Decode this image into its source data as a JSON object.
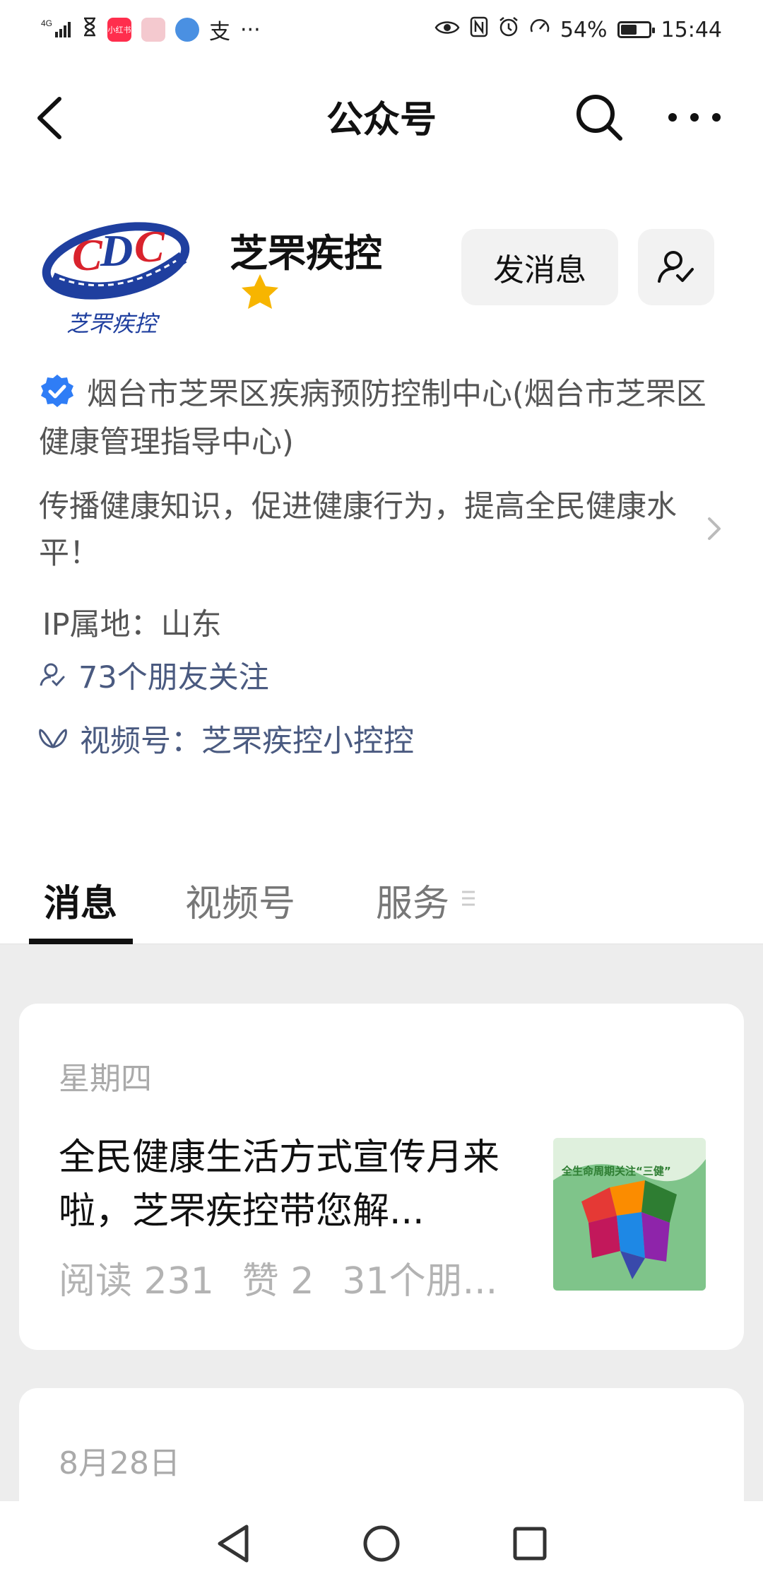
{
  "status_bar": {
    "network": "4G",
    "app_chip_label": "小红书",
    "extra_label": "支",
    "more": "···",
    "battery": "54%",
    "time": "15:44"
  },
  "header": {
    "title": "公众号"
  },
  "account": {
    "name": "芝罘疾控",
    "logo_caption": "芝罘疾控",
    "message_button": "发消息",
    "verified_org": "烟台市芝罘区疾病预防控制中心(烟台市芝罘区健康管理指导中心)",
    "description": "传播健康知识，促进健康行为，提高全民健康水平！",
    "ip_location": "IP属地：山东",
    "friends_following": "73个朋友关注",
    "channels": "视频号：芝罘疾控小控控"
  },
  "tabs": [
    {
      "label": "消息"
    },
    {
      "label": "视频号"
    },
    {
      "label": "服务"
    }
  ],
  "messages": [
    {
      "date": "星期四",
      "title": "全民健康生活方式宣传月来啦，芝罘疾控带您解...",
      "reads": "阅读 231",
      "likes": "赞 2",
      "friends": "31个朋...",
      "thumb_caption": "全生命周期关注“三健”"
    },
    {
      "date": "8月28日"
    }
  ],
  "colors": {
    "accent_link": "#4a5a80",
    "star": "#f7b500",
    "verified_badge": "#2f7df6"
  }
}
